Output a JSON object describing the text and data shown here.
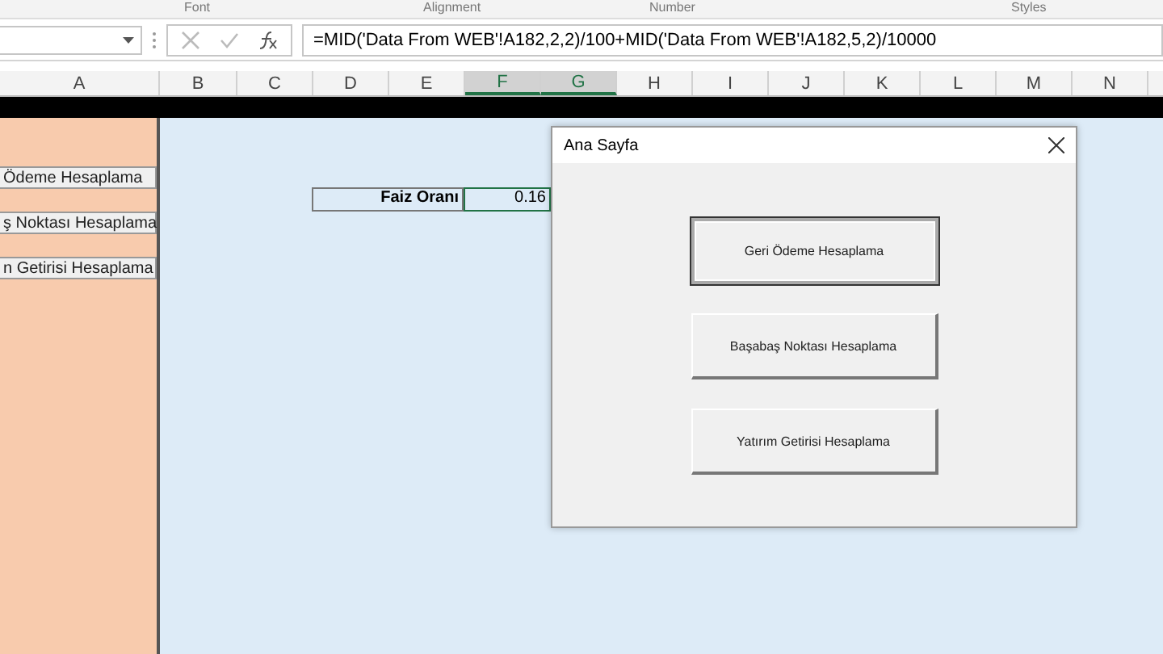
{
  "ribbon_groups": [
    "Font",
    "Alignment",
    "Number",
    "Styles"
  ],
  "formula_bar": {
    "formula": "=MID('Data From WEB'!A182,2,2)/100+MID('Data From WEB'!A182,5,2)/10000"
  },
  "columns": [
    {
      "label": "A",
      "selected": false
    },
    {
      "label": "B",
      "selected": false
    },
    {
      "label": "C",
      "selected": false
    },
    {
      "label": "D",
      "selected": false
    },
    {
      "label": "E",
      "selected": false
    },
    {
      "label": "F",
      "selected": true
    },
    {
      "label": "G",
      "selected": true
    },
    {
      "label": "H",
      "selected": false
    },
    {
      "label": "I",
      "selected": false
    },
    {
      "label": "J",
      "selected": false
    },
    {
      "label": "K",
      "selected": false
    },
    {
      "label": "L",
      "selected": false
    },
    {
      "label": "M",
      "selected": false
    },
    {
      "label": "N",
      "selected": false
    }
  ],
  "sheet_buttons": [
    "Ödeme Hesaplama",
    "ş Noktası Hesaplama",
    "n Getirisi Hesaplama"
  ],
  "cells": {
    "label": "Faiz Oranı",
    "value": "0.16"
  },
  "dialog": {
    "title": "Ana Sayfa",
    "buttons": [
      {
        "label": "Geri Ödeme Hesaplama",
        "selected": true
      },
      {
        "label": "Başabaş Noktası Hesaplama",
        "selected": false
      },
      {
        "label": "Yatırım Getirisi Hesaplama",
        "selected": false
      }
    ]
  }
}
